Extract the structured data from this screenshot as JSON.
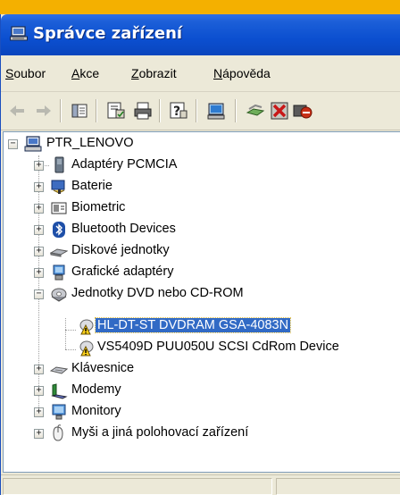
{
  "window": {
    "title": "Správce zařízení",
    "title_icon": "computer-management-icon"
  },
  "menu": {
    "items": [
      {
        "label": "Soubor",
        "underline": "S"
      },
      {
        "label": "Akce",
        "underline": "A"
      },
      {
        "label": "Zobrazit",
        "underline": "Z"
      },
      {
        "label": "Nápověda",
        "underline": "N"
      }
    ]
  },
  "toolbar": {
    "buttons": [
      "back-icon",
      "forward-icon",
      "show-hide-tree-icon",
      "properties-icon",
      "print-icon",
      "help-icon",
      "scan-hardware-icon",
      "update-driver-icon",
      "uninstall-icon",
      "disable-icon"
    ]
  },
  "tree": {
    "root": {
      "label": "PTR_LENOVO",
      "icon": "computer-icon"
    },
    "categories": [
      {
        "label": "Adaptéry PCMCIA",
        "icon": "pcmcia-icon",
        "expanded": false
      },
      {
        "label": "Baterie",
        "icon": "battery-icon",
        "expanded": false
      },
      {
        "label": "Biometric",
        "icon": "biometric-icon",
        "expanded": false
      },
      {
        "label": "Bluetooth Devices",
        "icon": "bluetooth-icon",
        "expanded": false
      },
      {
        "label": "Diskové jednotky",
        "icon": "disk-drive-icon",
        "expanded": false
      },
      {
        "label": "Grafické adaptéry",
        "icon": "display-adapter-icon",
        "expanded": false
      },
      {
        "label": "Jednotky DVD nebo CD-ROM",
        "icon": "dvd-drive-icon",
        "expanded": true,
        "children": [
          {
            "label": "HL-DT-ST DVDRAM GSA-4083N",
            "icon": "dvd-warning-icon",
            "selected": true
          },
          {
            "label": "VS5409D PUU050U SCSI CdRom Device",
            "icon": "dvd-warning-icon",
            "selected": false
          }
        ]
      },
      {
        "label": "Klávesnice",
        "icon": "keyboard-icon",
        "expanded": false
      },
      {
        "label": "Modemy",
        "icon": "modem-icon",
        "expanded": false
      },
      {
        "label": "Monitory",
        "icon": "monitor-icon",
        "expanded": false
      },
      {
        "label": "Myši a jiná polohovací zařízení",
        "icon": "mouse-icon",
        "expanded": false
      }
    ]
  },
  "colors": {
    "titlebar": "#0b4fd0",
    "selection": "#316ac5",
    "window_bg": "#ece9d8",
    "outer_bg": "#f4b000"
  }
}
